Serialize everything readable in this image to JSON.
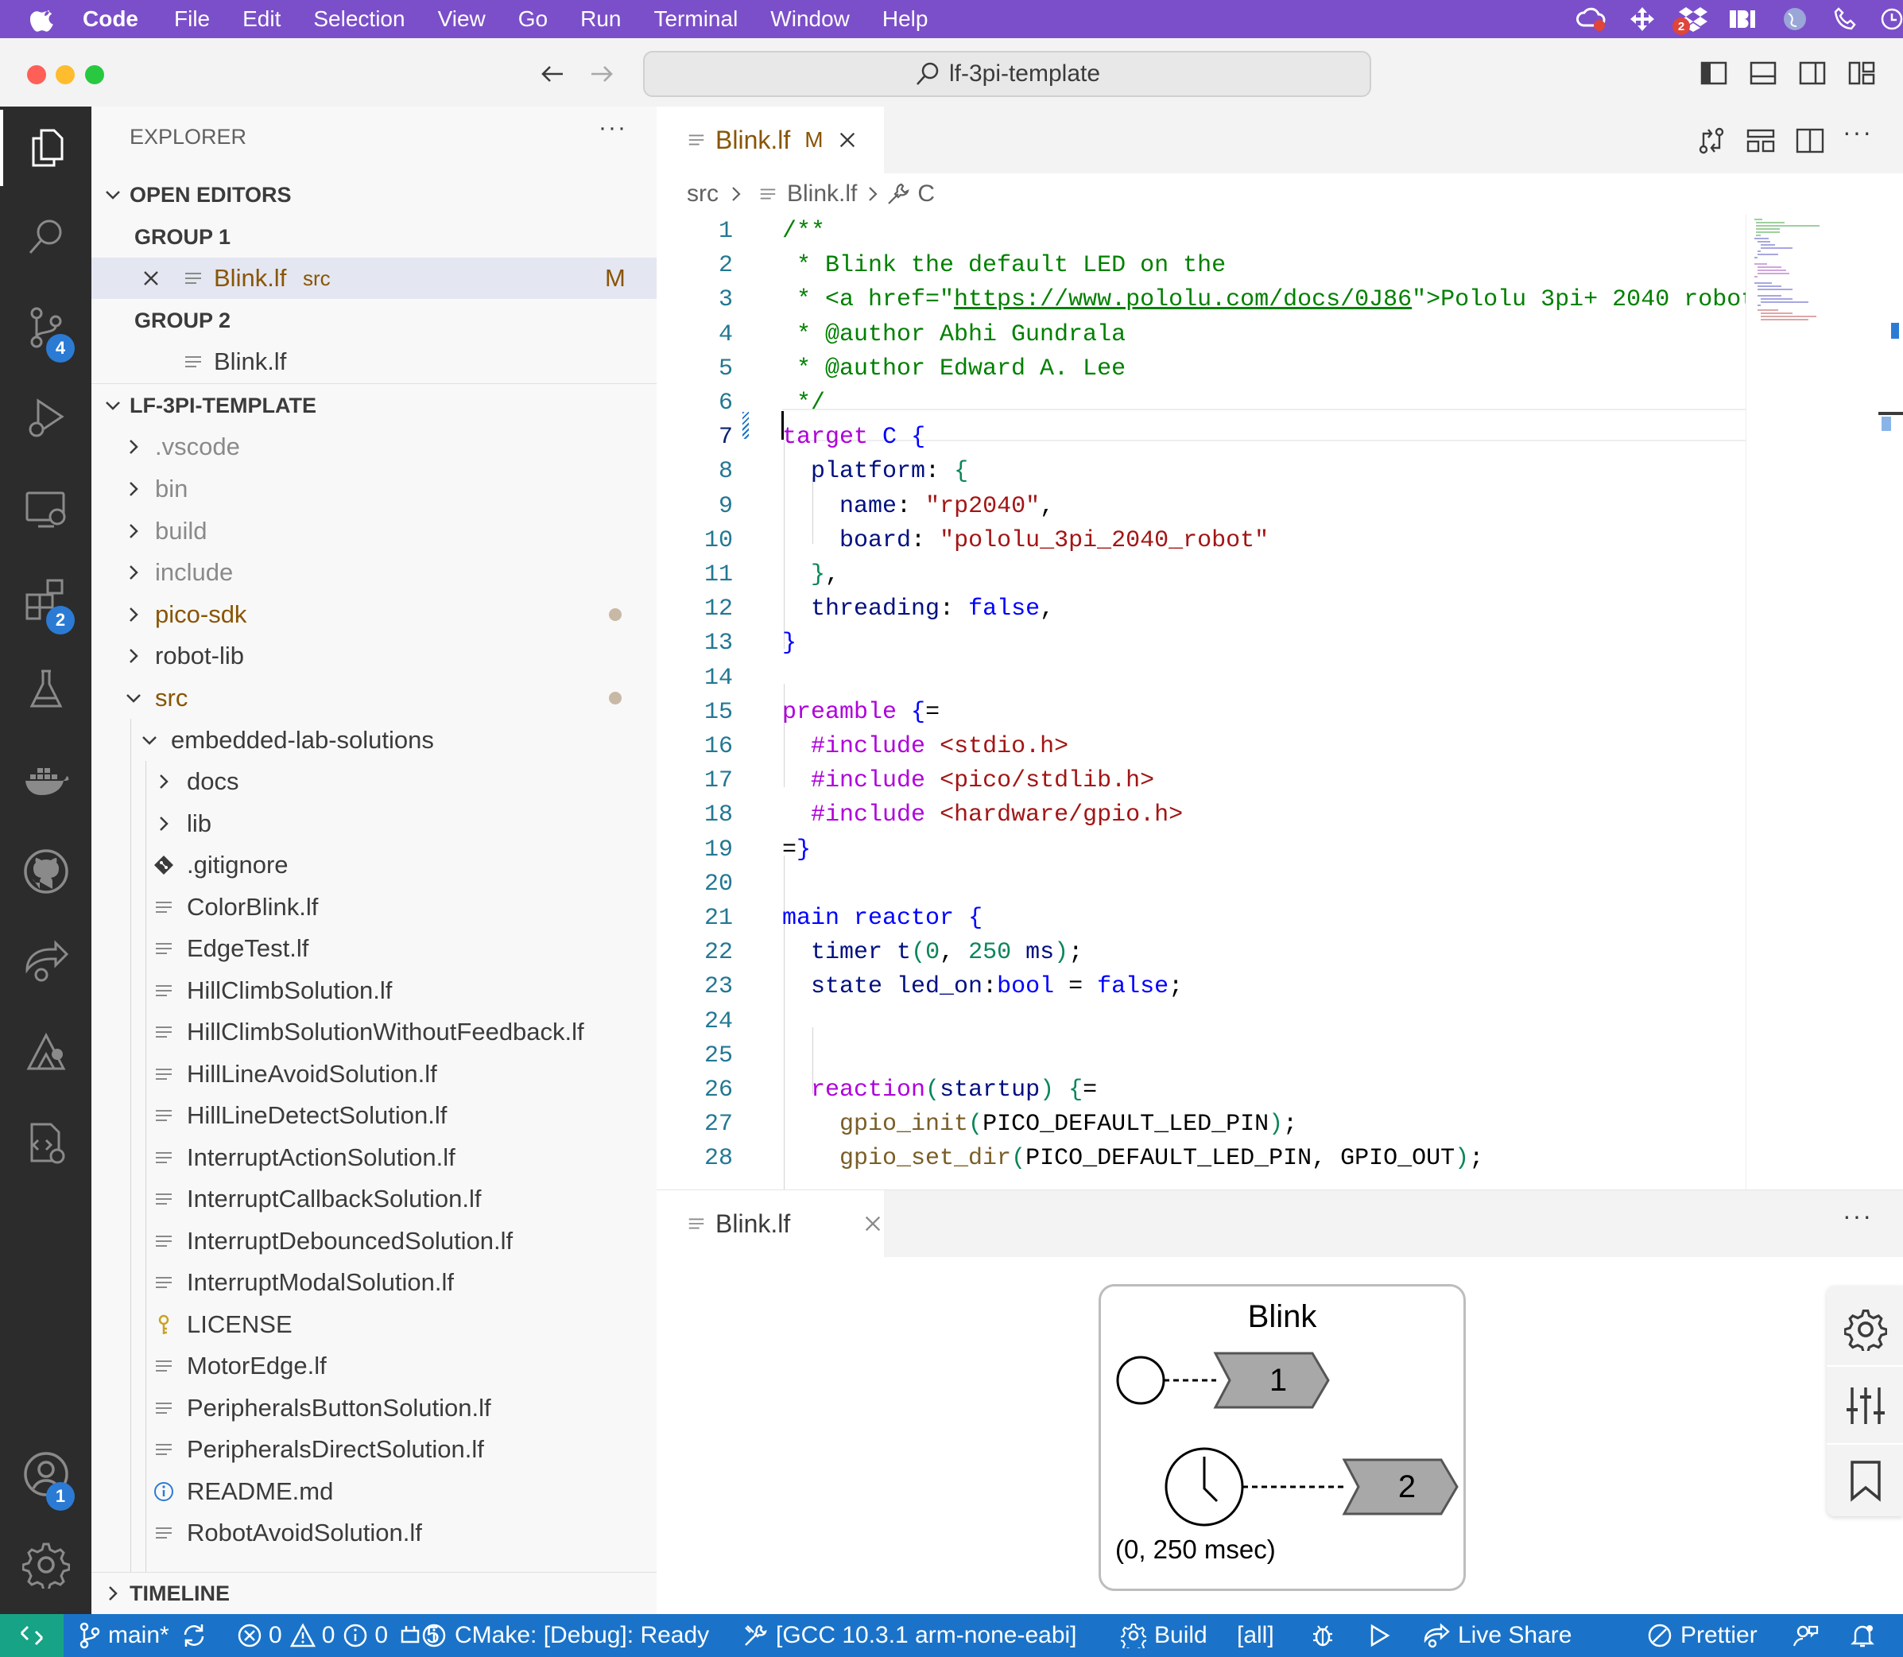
{
  "menubar": {
    "app": "Code",
    "items": [
      "File",
      "Edit",
      "Selection",
      "View",
      "Go",
      "Run",
      "Terminal",
      "Window",
      "Help"
    ],
    "tray_badge_dropbox": "2"
  },
  "window": {
    "search_text": "lf-3pi-template"
  },
  "activity": {
    "scm_badge": "4",
    "extensions_badge": "2",
    "accounts_badge": "1"
  },
  "explorer": {
    "title": "EXPLORER",
    "open_editors_label": "OPEN EDITORS",
    "group1_label": "GROUP 1",
    "group1_file": "Blink.lf",
    "group1_folder": "src",
    "group1_status": "M",
    "group2_label": "GROUP 2",
    "group2_file": "Blink.lf",
    "project_label": "LF-3PI-TEMPLATE",
    "folders": [
      ".vscode",
      "bin",
      "build",
      "include",
      "pico-sdk",
      "robot-lib",
      "src"
    ],
    "subfolder": "embedded-lab-solutions",
    "sub_items": [
      "docs",
      "lib",
      ".gitignore",
      "ColorBlink.lf",
      "EdgeTest.lf",
      "HillClimbSolution.lf",
      "HillClimbSolutionWithoutFeedback.lf",
      "HillLineAvoidSolution.lf",
      "HillLineDetectSolution.lf",
      "InterruptActionSolution.lf",
      "InterruptCallbackSolution.lf",
      "InterruptDebouncedSolution.lf",
      "InterruptModalSolution.lf",
      "LICENSE",
      "MotorEdge.lf",
      "PeripheralsButtonSolution.lf",
      "PeripheralsDirectSolution.lf",
      "README.md",
      "RobotAvoidSolution.lf"
    ],
    "timeline_label": "TIMELINE"
  },
  "editor": {
    "tab_label": "Blink.lf",
    "tab_status": "M",
    "breadcrumb": [
      "src",
      "Blink.lf",
      "C"
    ],
    "line_numbers": [
      "1",
      "2",
      "3",
      "4",
      "5",
      "6",
      "7",
      "8",
      "9",
      "10",
      "11",
      "12",
      "13",
      "14",
      "15",
      "16",
      "17",
      "18",
      "19",
      "20",
      "21",
      "22",
      "23",
      "24",
      "25",
      "26",
      "27",
      "28"
    ]
  },
  "panel": {
    "tab_label": "Blink.lf",
    "diagram_title": "Blink",
    "reaction1": "1",
    "reaction2": "2",
    "timer_label": "(0, 250 msec)"
  },
  "statusbar": {
    "branch": "main*",
    "errors": "0",
    "warnings": "0",
    "infos": "0",
    "ports": "5",
    "cmake": "CMake: [Debug]: Ready",
    "kit": "[GCC 10.3.1 arm-none-eabi]",
    "build": "Build",
    "target": "[all]",
    "liveshare": "Live Share",
    "prettier": "Prettier"
  },
  "colors": {
    "menubar": "#7b4fc9",
    "statusbar": "#1a73c9",
    "remote": "#17a386",
    "modified": "#895503",
    "badge": "#2b7bd4"
  }
}
